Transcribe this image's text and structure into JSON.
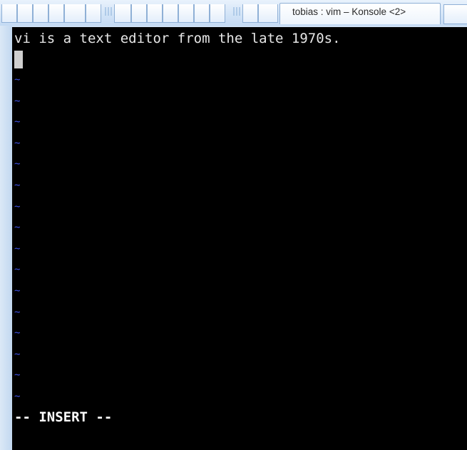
{
  "window": {
    "title": "tobias : vim – Konsole <2>"
  },
  "editor": {
    "text_line": "vi is a text editor from the late 1970s.",
    "tilde": "~",
    "tilde_rows": 16,
    "mode_line": "-- INSERT --"
  },
  "colors": {
    "terminal_bg": "#000000",
    "text": "#e6e6e6",
    "tilde": "#3d52e6",
    "cursor": "#cfcfcf"
  }
}
